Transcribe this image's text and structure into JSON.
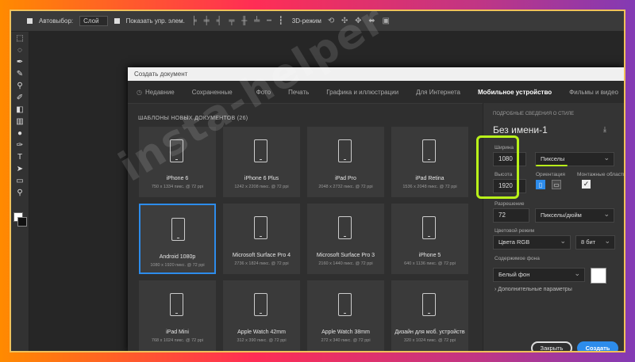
{
  "watermark": "insta-helper",
  "optionsbar": {
    "autoselect_label": "Автовыбор:",
    "layer_select": "Слой",
    "transform_label": "Показать упр. элем.",
    "mode3d": "3D-режим"
  },
  "dialog": {
    "title": "Создать документ",
    "tabs": [
      {
        "label": "Недавние",
        "active": false
      },
      {
        "label": "Сохраненные",
        "active": false
      },
      {
        "label": "Фото",
        "active": false
      },
      {
        "label": "Печать",
        "active": false
      },
      {
        "label": "Графика и иллюстрации",
        "active": false
      },
      {
        "label": "Для Интернета",
        "active": false
      },
      {
        "label": "Мобильное устройство",
        "active": true
      },
      {
        "label": "Фильмы и видео",
        "active": false
      }
    ],
    "templates_heading": "ШАБЛОНЫ НОВЫХ ДОКУМЕНТОВ",
    "templates_count": "(26)",
    "templates": [
      {
        "name": "iPhone 6",
        "desc": "750 x 1334 пикс. @ 72 ppi"
      },
      {
        "name": "iPhone 6 Plus",
        "desc": "1242 x 2208 пикс. @ 72 ppi"
      },
      {
        "name": "iPad Pro",
        "desc": "2048 x 2732 пикс. @ 72 ppi"
      },
      {
        "name": "iPad Retina",
        "desc": "1536 x 2048 пикс. @ 72 ppi"
      },
      {
        "name": "Android 1080p",
        "desc": "1080 x 1920 пикс. @ 72 ppi",
        "selected": true
      },
      {
        "name": "Microsoft Surface Pro 4",
        "desc": "2736 x 1824 пикс. @ 72 ppi"
      },
      {
        "name": "Microsoft Surface Pro 3",
        "desc": "2160 x 1440 пикс. @ 72 ppi"
      },
      {
        "name": "iPhone 5",
        "desc": "640 x 1136 пикс. @ 72 ppi"
      },
      {
        "name": "iPad Mini",
        "desc": "768 x 1024 пикс. @ 72 ppi"
      },
      {
        "name": "Apple Watch 42mm",
        "desc": "312 x 390 пикс. @ 72 ppi"
      },
      {
        "name": "Apple Watch 38mm",
        "desc": "272 x 340 пикс. @ 72 ppi"
      },
      {
        "name": "Дизайн для моб. устройств",
        "desc": "320 x 1024 пикс. @ 72 ppi"
      }
    ],
    "details": {
      "heading": "ПОДРОБНЫЕ СВЕДЕНИЯ О СТИЛЕ",
      "doc_name": "Без имени-1",
      "width_label": "Ширина",
      "width_value": "1080",
      "units": "Пикселы",
      "height_label": "Высота",
      "height_value": "1920",
      "orientation_label": "Ориентация",
      "artboards_label": "Монтажные области",
      "resolution_label": "Разрешение",
      "resolution_value": "72",
      "resolution_units": "Пикселы/дюйм",
      "color_mode_label": "Цветовой режим",
      "color_mode_value": "Цвета RGB",
      "bit_depth": "8 бит",
      "bg_label": "Содержимое фона",
      "bg_value": "Белый фон",
      "advanced": "Дополнительные параметры"
    },
    "buttons": {
      "close": "Закрыть",
      "create": "Создать"
    }
  },
  "colors": {
    "accent": "#2d8ceb",
    "highlight": "#b9f21a"
  }
}
